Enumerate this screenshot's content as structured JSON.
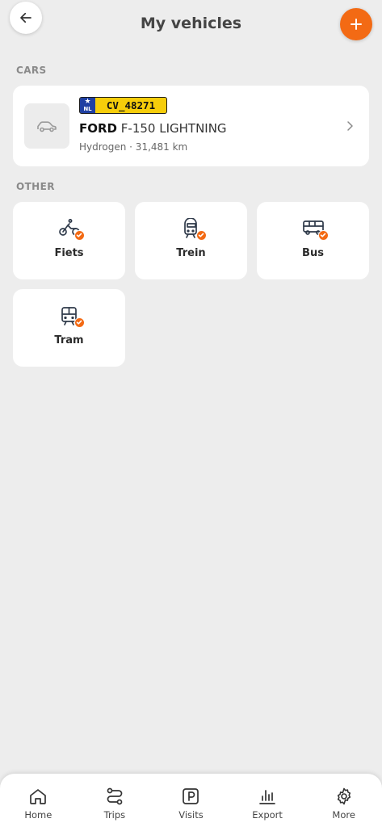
{
  "header": {
    "title": "My vehicles",
    "back_icon": "arrow-left-icon",
    "add_icon": "plus-icon",
    "accent_color": "#f36a14"
  },
  "sections": {
    "cars_label": "CARS",
    "other_label": "OTHER"
  },
  "car": {
    "plate_country": "NL",
    "plate_number": "CV_48271",
    "make": "FORD",
    "model": "F-150 LIGHTNING",
    "meta": "Hydrogen · 31,481 km",
    "thumb_icon": "car-icon",
    "chevron_icon": "chevron-right-icon"
  },
  "other_vehicles": [
    {
      "label": "Fiets",
      "icon": "bicycle-icon",
      "selected": true
    },
    {
      "label": "Trein",
      "icon": "train-icon",
      "selected": true
    },
    {
      "label": "Bus",
      "icon": "bus-icon",
      "selected": true
    },
    {
      "label": "Tram",
      "icon": "tram-icon",
      "selected": true
    }
  ],
  "nav": [
    {
      "label": "Home",
      "icon": "home-icon"
    },
    {
      "label": "Trips",
      "icon": "route-icon"
    },
    {
      "label": "Visits",
      "icon": "parking-icon"
    },
    {
      "label": "Export",
      "icon": "bar-chart-icon"
    },
    {
      "label": "More",
      "icon": "gear-icon"
    }
  ]
}
